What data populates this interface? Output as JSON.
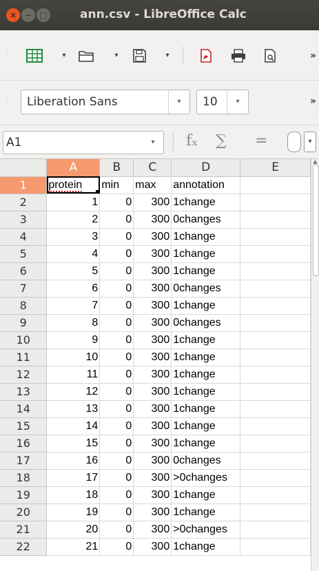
{
  "window": {
    "title": "ann.csv - LibreOffice Calc",
    "close_glyph": "×",
    "min_glyph": "−",
    "max_glyph": "□"
  },
  "toolbar": {
    "overflow": "»",
    "dropdown_arrow": "▾"
  },
  "font_toolbar": {
    "font_name": "Liberation Sans",
    "font_size": "10",
    "overflow": "»",
    "dropdown_arrow": "▾"
  },
  "formula_bar": {
    "name_box": "A1",
    "dropdown_arrow": "▾",
    "function_wizard": "fₓ",
    "sum": "∑",
    "equals": "="
  },
  "icons": {
    "grid": "table-icon",
    "folder": "folder-icon",
    "save": "save-icon",
    "pdf": "pdf-export-icon",
    "print": "print-icon",
    "preview": "print-preview-icon"
  },
  "colors": {
    "accent": "#e95420",
    "active_header": "#f49a6e"
  },
  "sheet": {
    "columns": [
      "A",
      "B",
      "C",
      "D",
      "E"
    ],
    "active_column": "A",
    "active_row": "1",
    "header_row": {
      "row": "1",
      "cells": [
        "protein",
        "min",
        "max",
        "annotation",
        ""
      ]
    },
    "rows": [
      {
        "row": "2",
        "cells": [
          "1",
          "0",
          "300",
          "1change",
          ""
        ]
      },
      {
        "row": "3",
        "cells": [
          "2",
          "0",
          "300",
          "0changes",
          ""
        ]
      },
      {
        "row": "4",
        "cells": [
          "3",
          "0",
          "300",
          "1change",
          ""
        ]
      },
      {
        "row": "5",
        "cells": [
          "4",
          "0",
          "300",
          "1change",
          ""
        ]
      },
      {
        "row": "6",
        "cells": [
          "5",
          "0",
          "300",
          "1change",
          ""
        ]
      },
      {
        "row": "7",
        "cells": [
          "6",
          "0",
          "300",
          "0changes",
          ""
        ]
      },
      {
        "row": "8",
        "cells": [
          "7",
          "0",
          "300",
          "1change",
          ""
        ]
      },
      {
        "row": "9",
        "cells": [
          "8",
          "0",
          "300",
          "0changes",
          ""
        ]
      },
      {
        "row": "10",
        "cells": [
          "9",
          "0",
          "300",
          "1change",
          ""
        ]
      },
      {
        "row": "11",
        "cells": [
          "10",
          "0",
          "300",
          "1change",
          ""
        ]
      },
      {
        "row": "12",
        "cells": [
          "11",
          "0",
          "300",
          "1change",
          ""
        ]
      },
      {
        "row": "13",
        "cells": [
          "12",
          "0",
          "300",
          "1change",
          ""
        ]
      },
      {
        "row": "14",
        "cells": [
          "13",
          "0",
          "300",
          "1change",
          ""
        ]
      },
      {
        "row": "15",
        "cells": [
          "14",
          "0",
          "300",
          "1change",
          ""
        ]
      },
      {
        "row": "16",
        "cells": [
          "15",
          "0",
          "300",
          "1change",
          ""
        ]
      },
      {
        "row": "17",
        "cells": [
          "16",
          "0",
          "300",
          "0changes",
          ""
        ]
      },
      {
        "row": "18",
        "cells": [
          "17",
          "0",
          "300",
          ">0changes",
          ""
        ]
      },
      {
        "row": "19",
        "cells": [
          "18",
          "0",
          "300",
          "1change",
          ""
        ]
      },
      {
        "row": "20",
        "cells": [
          "19",
          "0",
          "300",
          "1change",
          ""
        ]
      },
      {
        "row": "21",
        "cells": [
          "20",
          "0",
          "300",
          ">0changes",
          ""
        ]
      },
      {
        "row": "22",
        "cells": [
          "21",
          "0",
          "300",
          "1change",
          ""
        ]
      }
    ]
  }
}
